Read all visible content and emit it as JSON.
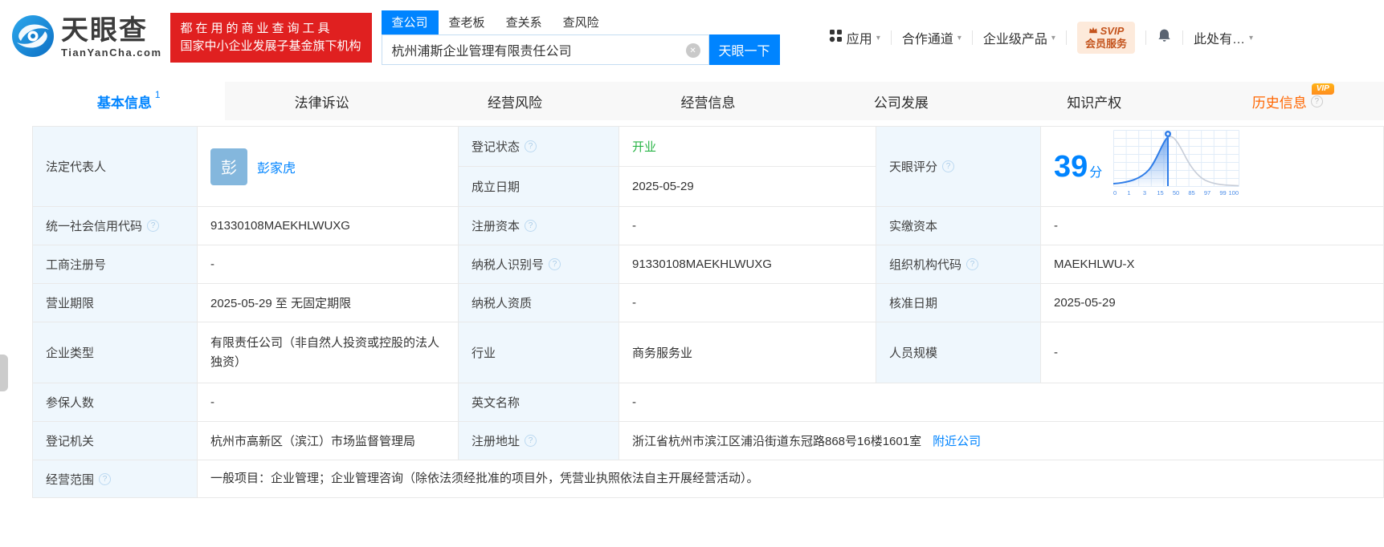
{
  "brand": {
    "name": "天眼查",
    "domain": "TianYanCha.com",
    "slogan1": "都在用的商业查询工具",
    "slogan2": "国家中小企业发展子基金旗下机构"
  },
  "search": {
    "tabs": [
      "查公司",
      "查老板",
      "查关系",
      "查风险"
    ],
    "active_tab": "查公司",
    "input_value": "杭州浦斯企业管理有限责任公司",
    "button": "天眼一下"
  },
  "top_menu": {
    "apps": "应用",
    "cooperation": "合作通道",
    "enterprise_products": "企业级产品",
    "svip_top": "SVIP",
    "svip_bottom": "会员服务",
    "more": "此处有…"
  },
  "nav": {
    "tabs": [
      {
        "label": "基本信息",
        "badge": "1"
      },
      {
        "label": "法律诉讼"
      },
      {
        "label": "经营风险"
      },
      {
        "label": "经营信息"
      },
      {
        "label": "公司发展"
      },
      {
        "label": "知识产权"
      },
      {
        "label": "历史信息",
        "vip": "VIP"
      }
    ]
  },
  "fields": {
    "legal_rep": {
      "label": "法定代表人",
      "avatar_char": "彭",
      "name": "彭家虎"
    },
    "reg_status": {
      "label": "登记状态",
      "value": "开业"
    },
    "establish_date": {
      "label": "成立日期",
      "value": "2025-05-29"
    },
    "score": {
      "label": "天眼评分",
      "value": "39",
      "unit": "分"
    },
    "credit_code": {
      "label": "统一社会信用代码",
      "value": "91330108MAEKHLWUXG"
    },
    "reg_capital": {
      "label": "注册资本",
      "value": "-"
    },
    "paid_capital": {
      "label": "实缴资本",
      "value": "-"
    },
    "reg_number": {
      "label": "工商注册号",
      "value": "-"
    },
    "taxpayer_id": {
      "label": "纳税人识别号",
      "value": "91330108MAEKHLWUXG"
    },
    "org_code": {
      "label": "组织机构代码",
      "value": "MAEKHLWU-X"
    },
    "business_term": {
      "label": "营业期限",
      "value": "2025-05-29 至 无固定期限"
    },
    "taxpayer_quality": {
      "label": "纳税人资质",
      "value": "-"
    },
    "approval_date": {
      "label": "核准日期",
      "value": "2025-05-29"
    },
    "company_type": {
      "label": "企业类型",
      "value": "有限责任公司（非自然人投资或控股的法人独资）"
    },
    "industry": {
      "label": "行业",
      "value": "商务服务业"
    },
    "staff_size": {
      "label": "人员规模",
      "value": "-"
    },
    "insured_count": {
      "label": "参保人数",
      "value": "-"
    },
    "english_name": {
      "label": "英文名称",
      "value": "-"
    },
    "reg_authority": {
      "label": "登记机关",
      "value": "杭州市高新区（滨江）市场监督管理局"
    },
    "reg_address": {
      "label": "注册地址",
      "value": "浙江省杭州市滨江区浦沿街道东冠路868号16楼1601室",
      "link": "附近公司"
    },
    "business_scope": {
      "label": "经营范围",
      "value": "一般项目：企业管理；企业管理咨询（除依法须经批准的项目外，凭营业执照依法自主开展经营活动）。"
    }
  },
  "score_chart": {
    "type": "area",
    "score": 39,
    "unit": "分",
    "x_ticks": [
      "0",
      "1",
      "3",
      "15",
      "50",
      "85",
      "97",
      "99",
      "100"
    ],
    "description": "bell-curve score distribution, blue filled up to marker at score 39, gray beyond"
  },
  "icons": {
    "help": "?",
    "clear": "✕",
    "caret": "▾"
  },
  "colors": {
    "accent": "#0084ff",
    "open_green": "#28b446",
    "history_orange": "#ff6600",
    "banner_red": "#e02020",
    "label_bg": "#eff7fd"
  }
}
